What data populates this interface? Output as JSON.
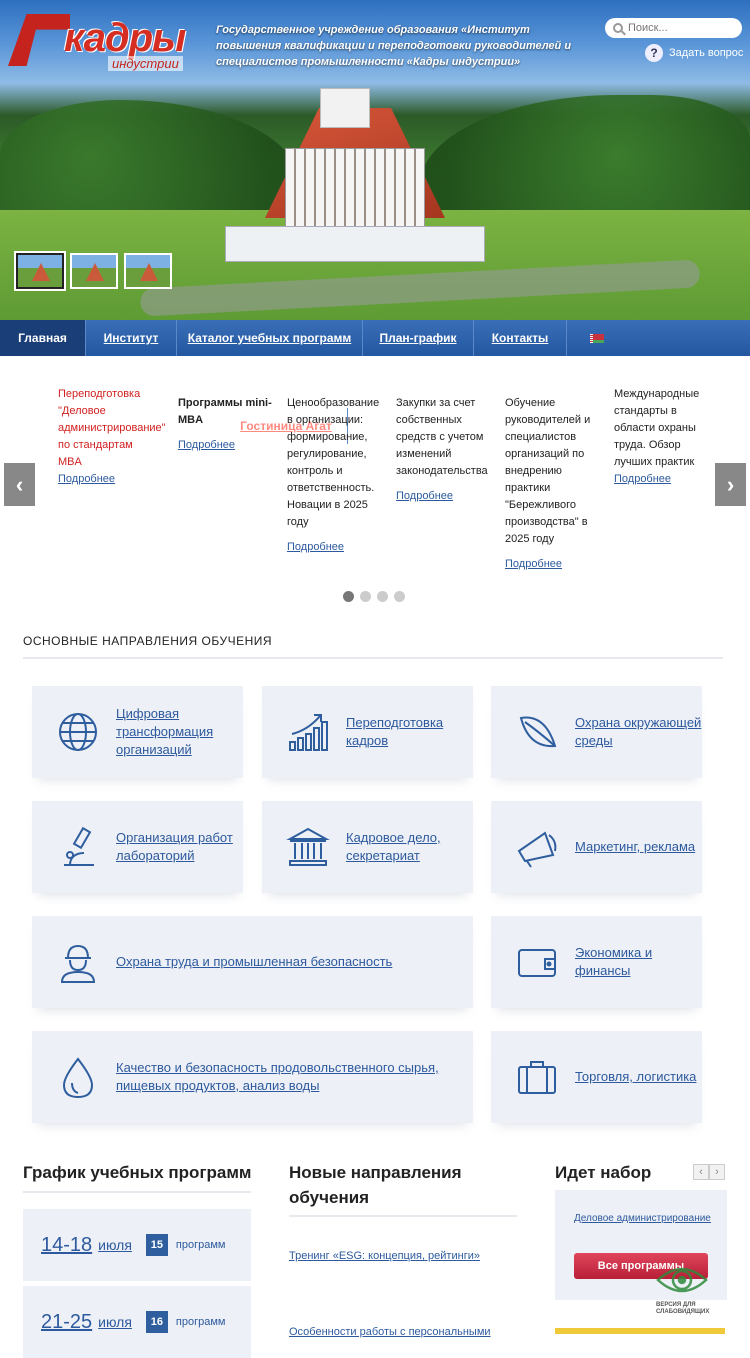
{
  "header": {
    "logo_word": "кадры",
    "logo_sub": "индустрии",
    "org_text": "Государственное учреждение образования «Институт повышения квалификации и переподготовки руководителей и специалистов промышленности «Кадры индустрии»",
    "search_placeholder": "Поиск...",
    "ask_label": "Задать вопрос"
  },
  "nav": {
    "items": [
      {
        "label": "Главная"
      },
      {
        "label": "Институт"
      },
      {
        "label": "Каталог учебных программ"
      },
      {
        "label": "План-график"
      },
      {
        "label": "Гостиница Агат"
      },
      {
        "label": "Контакты"
      }
    ]
  },
  "carousel": {
    "more_label": "Подробнее",
    "slides": [
      {
        "text": "Переподготовка \"Деловое администрирование\" по стандартам MBA"
      },
      {
        "text": "Программы mini-MBA"
      },
      {
        "text": "Ценообразование в организации: формирование, регулирование, контроль и ответственность. Новации в 2025 году"
      },
      {
        "text": "Закупки за счет собственных средств с учетом изменений законодательства"
      },
      {
        "text": "Обучение руководителей и специалистов организаций по внедрению практики \"Бережливого производства\" в 2025 году"
      },
      {
        "text": "Международные стандарты в области охраны труда. Обзор лучших практик"
      }
    ],
    "prev": "‹",
    "next": "›"
  },
  "directions": {
    "title": "ОСНОВНЫЕ НАПРАВЛЕНИЯ ОБУЧЕНИЯ",
    "cards": [
      {
        "label": "Цифровая трансформация организаций",
        "icon": "globe-icon"
      },
      {
        "label": "Переподготовка кадров",
        "icon": "growth-chart-icon"
      },
      {
        "label": "Охрана окружающей среды",
        "icon": "leaf-icon"
      },
      {
        "label": "Организация работ лабораторий",
        "icon": "microscope-icon"
      },
      {
        "label": "Кадровое дело, секретариат",
        "icon": "building-icon"
      },
      {
        "label": "Маркетинг, реклама",
        "icon": "megaphone-icon"
      },
      {
        "label": "Охрана труда и промышленная безопасность",
        "icon": "worker-helmet-icon"
      },
      {
        "label": "Экономика и финансы",
        "icon": "wallet-icon"
      },
      {
        "label": "Качество и безопасность продовольственного сырья, пищевых продуктов, анализ воды",
        "icon": "water-drop-icon"
      },
      {
        "label": "Торговля, логистика",
        "icon": "suitcase-icon"
      }
    ]
  },
  "schedule": {
    "title": "График учебных программ",
    "rows": [
      {
        "dates": "14-18",
        "month": "июля",
        "count": "15",
        "label": "программ"
      },
      {
        "dates": "21-25",
        "month": "июля",
        "count": "16",
        "label": "программ"
      }
    ]
  },
  "new_directions": {
    "title": "Новые направления обучения",
    "items": [
      {
        "text": "Тренинг «ESG: концепция, рейтинги»"
      },
      {
        "text": "Особенности работы с персональными"
      }
    ]
  },
  "enrollment": {
    "title": "Идет набор",
    "prev": "‹",
    "next": "›",
    "item": "Деловое администрирование",
    "button": "Все программы"
  },
  "accessibility": {
    "label": "ВЕРСИЯ ДЛЯ СЛАБОВИДЯЩИХ"
  },
  "colors": {
    "nav": "#2357a0",
    "link": "#2d5a9e",
    "card_bg": "#edf0f6",
    "accent_red": "#d21f1f"
  }
}
